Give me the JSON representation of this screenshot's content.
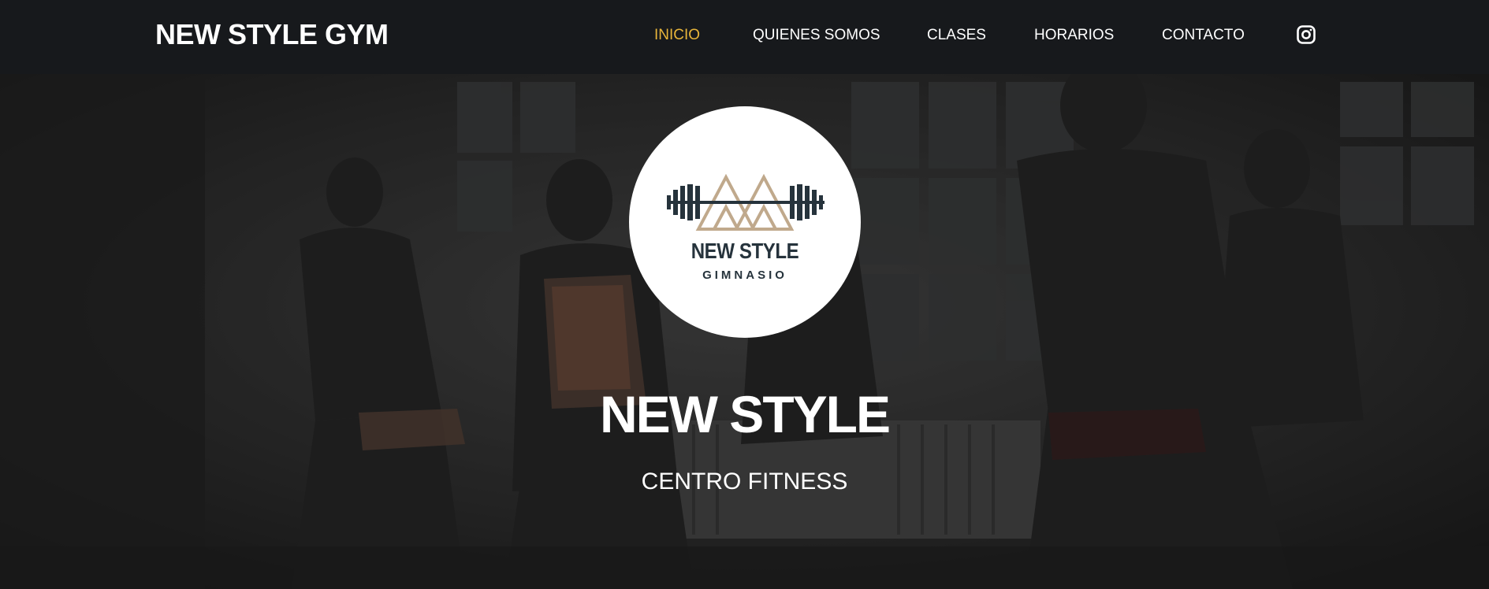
{
  "header": {
    "brand": "NEW STYLE GYM",
    "nav": [
      {
        "label": "INICIO",
        "active": true
      },
      {
        "label": "QUIENES SOMOS",
        "active": false
      },
      {
        "label": "CLASES",
        "active": false
      },
      {
        "label": "HORARIOS",
        "active": false
      },
      {
        "label": "CONTACTO",
        "active": false
      }
    ],
    "social_icon": "instagram-icon"
  },
  "hero": {
    "logo": {
      "line1": "NEW STYLE",
      "line2": "GIMNASIO"
    },
    "title": "NEW STYLE",
    "subtitle": "CENTRO FITNESS"
  },
  "colors": {
    "header_bg": "#17191c",
    "active_nav": "#e8b53a",
    "text": "#ffffff",
    "logo_dark": "#26333c",
    "logo_gold": "#c0a98c"
  }
}
